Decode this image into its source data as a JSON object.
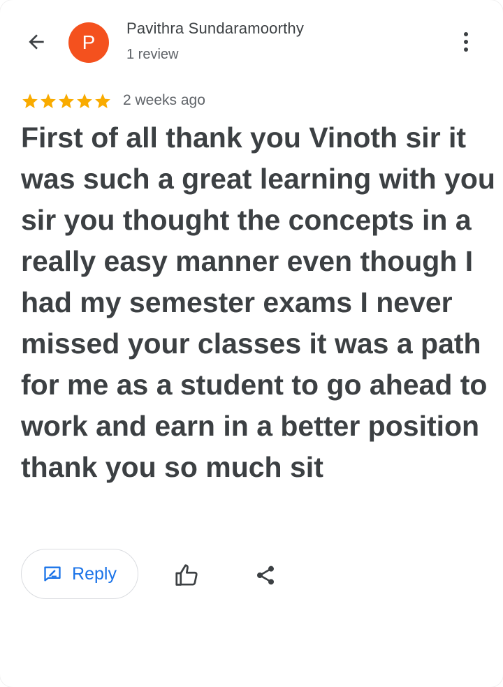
{
  "header": {
    "reviewer_name": "Pavithra Sundaramoorthy",
    "avatar_letter": "P",
    "review_count": "1 review",
    "avatar_color": "#f4511e"
  },
  "review": {
    "rating": 5,
    "rating_max": 5,
    "star_color": "#f9ab00",
    "time_ago": "2 weeks ago",
    "text": "First of all thank you Vinoth sir it was such a great learning with you sir you thought the concepts in a really easy manner even though I had my semester exams I never missed your classes it was a path for me as a student to go ahead to work and earn in a better position thank you so much sit"
  },
  "actions": {
    "reply_label": "Reply",
    "accent_color": "#1a73e8"
  },
  "icons": {
    "back": "back-arrow-icon",
    "menu": "more-vert-icon",
    "reply": "reply-icon",
    "like": "thumb-up-icon",
    "share": "share-icon"
  }
}
